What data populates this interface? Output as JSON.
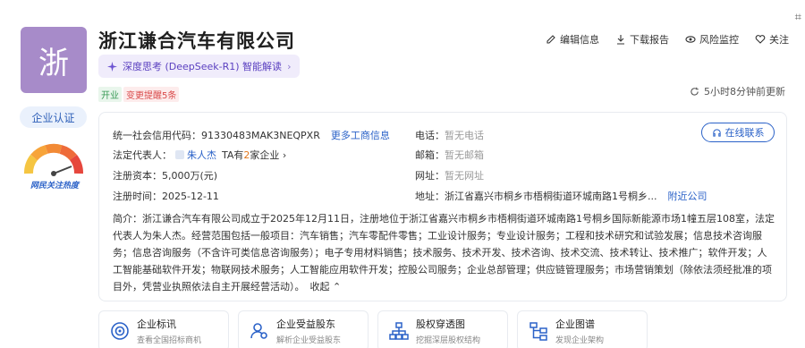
{
  "company": {
    "logo_char": "浙",
    "name": "浙江谦合汽车有限公司",
    "ai_pill": "深度思考 (DeepSeek-R1) 智能解读",
    "status_tag": "开业",
    "change_tag": "变更提醒5条",
    "cert_label": "企业认证",
    "heat_label": "网民关注热度"
  },
  "actions": {
    "edit": "编辑信息",
    "download": "下载报告",
    "monitor": "风险监控",
    "follow": "关注"
  },
  "updated_text": "5小时8分钟前更新",
  "info": {
    "credit_code_label": "统一社会信用代码：",
    "credit_code_value": "91330483MAK3NEQPXR",
    "more_info_link": "更多工商信息",
    "legal_rep_label": "法定代表人：",
    "legal_rep_value": "朱人杰",
    "legal_rep_extra_pre": "TA有",
    "legal_rep_extra_num": "2",
    "legal_rep_extra_post": "家企业 ›",
    "capital_label": "注册资本：",
    "capital_value": "5,000万(元)",
    "reg_time_label": "注册时间：",
    "reg_time_value": "2025-12-11",
    "phone_label": "电话：",
    "phone_value": "暂无电话",
    "email_label": "邮箱：",
    "email_value": "暂无邮箱",
    "website_label": "网址：",
    "website_value": "暂无网址",
    "address_label": "地址：",
    "address_value": "浙江省嘉兴市桐乡市梧桐街道环城南路1号桐乡...",
    "nearby_link": "附近公司",
    "online_btn": "在线联系",
    "intro_label": "简介：",
    "intro_text": "浙江谦合汽车有限公司成立于2025年12月11日，注册地位于浙江省嘉兴市桐乡市梧桐街道环城南路1号桐乡国际新能源市场1幢五层108室，法定代表人为朱人杰。经营范围包括一般项目：汽车销售；汽车零配件零售；工业设计服务；专业设计服务；工程和技术研究和试验发展；信息技术咨询服务；信息咨询服务（不含许可类信息咨询服务）；电子专用材料销售；技术服务、技术开发、技术咨询、技术交流、技术转让、技术推广；软件开发；人工智能基础软件开发；物联网技术服务；人工智能应用软件开发；控股公司服务；企业总部管理；供应链管理服务；市场营销策划（除依法须经批准的项目外，凭营业执照依法自主开展经营活动）。",
    "collapse": "收起 ⌃"
  },
  "tiles": [
    {
      "title": "企业标讯",
      "sub": "查看全国招标商机"
    },
    {
      "title": "企业受益股东",
      "sub": "解析企业受益股东"
    },
    {
      "title": "股权穿透图",
      "sub": "挖掘深层股权结构"
    },
    {
      "title": "企业图谱",
      "sub": "发现企业架构"
    }
  ],
  "colors": {
    "logo_bg": "#a78bc9",
    "link_blue": "#2b62c8",
    "ai_purple": "#5a3fc0"
  }
}
